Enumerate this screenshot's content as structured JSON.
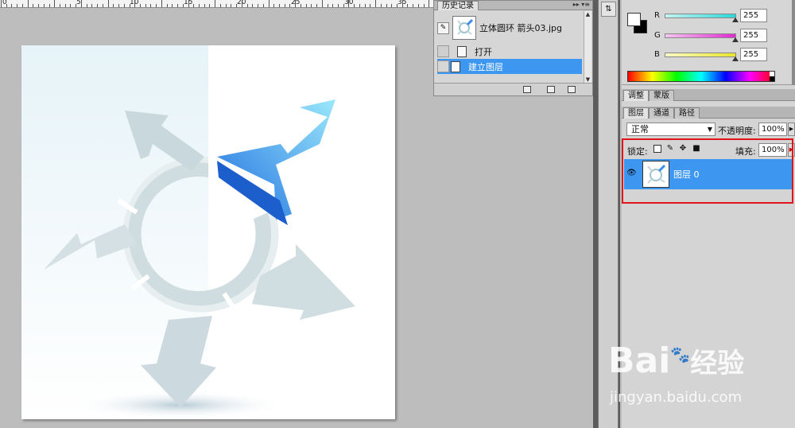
{
  "ruler": {
    "labels": [
      "0",
      "5",
      "10",
      "15",
      "20",
      "25",
      "30",
      "35"
    ]
  },
  "history": {
    "tab_label": "历史记录",
    "tab_menu_icon": "panel-menu-icon",
    "snapshot_name": "立体圆环 箭头03.jpg",
    "states": [
      {
        "label": "打开",
        "selected": false
      },
      {
        "label": "建立图层",
        "selected": true
      }
    ]
  },
  "color": {
    "channels": [
      {
        "name": "R",
        "value": "255",
        "color": "#2ad8d8"
      },
      {
        "name": "G",
        "value": "255",
        "color": "#e12bd1"
      },
      {
        "name": "B",
        "value": "255",
        "color": "#e8e62a"
      }
    ]
  },
  "adjust_tabs": [
    "调整",
    "蒙版"
  ],
  "layers_panel": {
    "tabs": [
      "图层",
      "通道",
      "路径"
    ],
    "blend_mode": "正常",
    "opacity_label": "不透明度:",
    "opacity_value": "100%",
    "lock_label": "锁定:",
    "fill_label": "填充:",
    "fill_value": "100%",
    "layer_name": "图层 0"
  },
  "watermark": {
    "brand": "Bai",
    "brand_suffix": "经验",
    "url": "jingyan.baidu.com"
  },
  "colors": {
    "selection_blue": "#3d96f0",
    "highlight_red": "#e0141b",
    "arrow_blue": "#3a8ee8"
  }
}
